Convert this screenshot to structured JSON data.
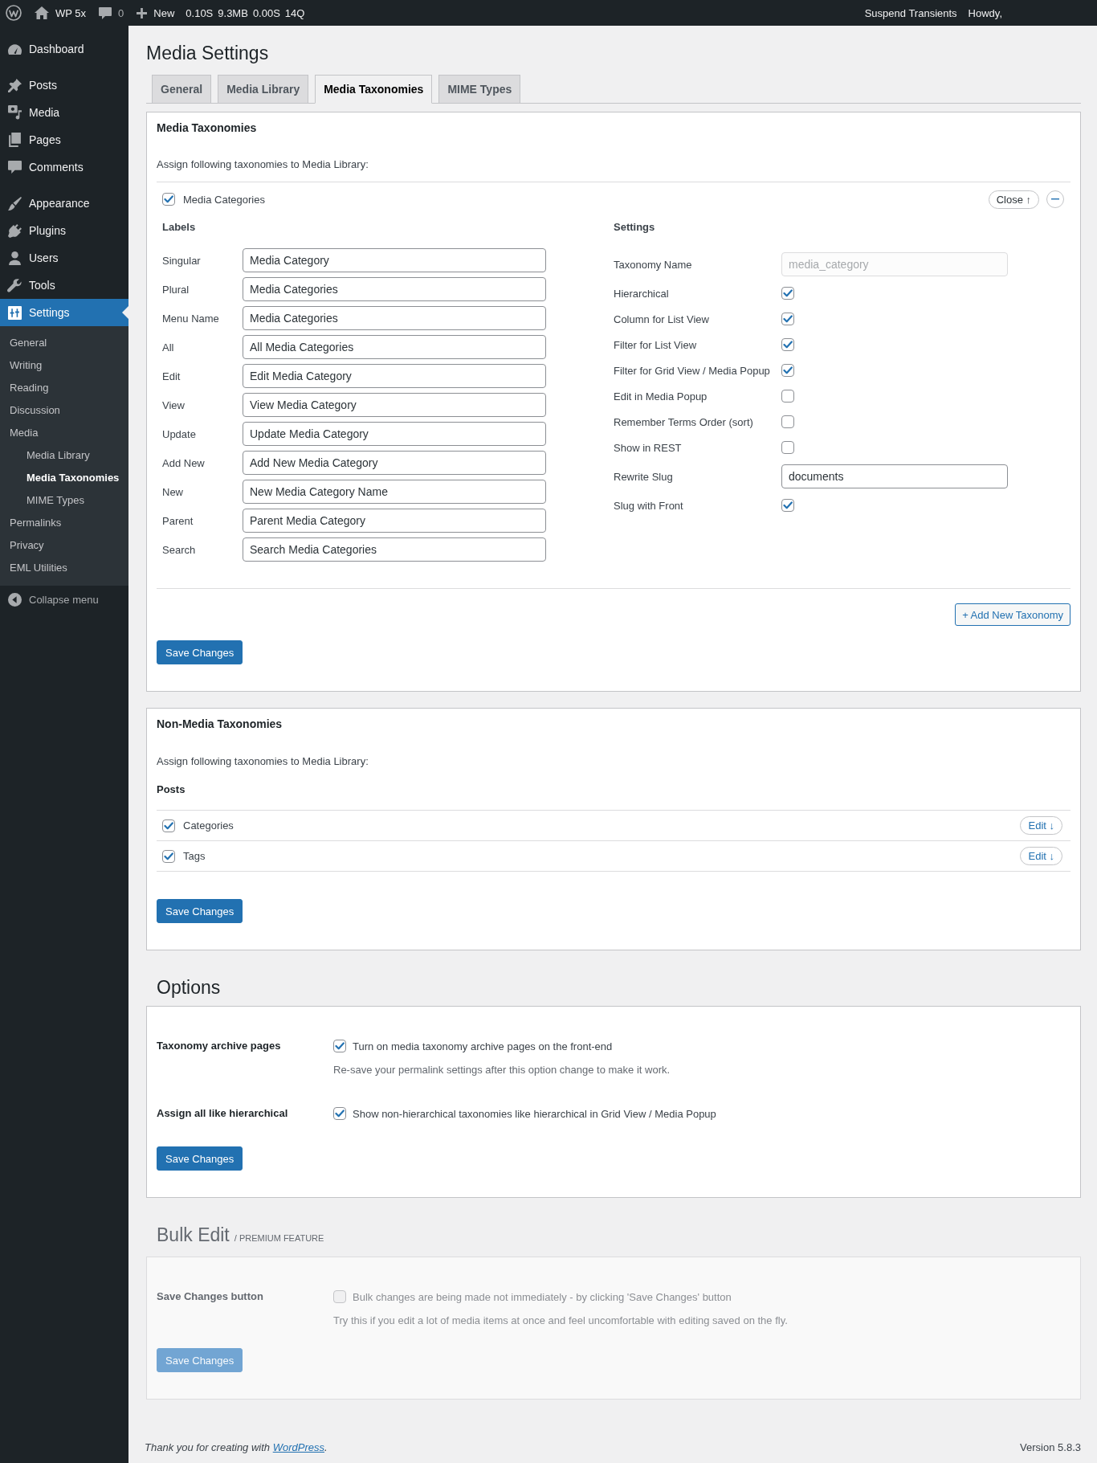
{
  "admin_bar": {
    "site_name": "WP 5x",
    "comments_count": "0",
    "new_label": "New",
    "stats": [
      "0.10S",
      "9.3MB",
      "0.00S",
      "14Q"
    ],
    "right_links": [
      "Suspend Transients",
      "Howdy,"
    ]
  },
  "sidebar": {
    "groups": [
      {
        "items": [
          {
            "label": "Dashboard",
            "selected": false
          }
        ]
      },
      {
        "items": [
          {
            "label": "Posts",
            "selected": false
          },
          {
            "label": "Media",
            "selected": false
          },
          {
            "label": "Pages",
            "selected": false
          },
          {
            "label": "Comments",
            "selected": false
          }
        ]
      },
      {
        "items": [
          {
            "label": "Appearance",
            "selected": false
          },
          {
            "label": "Plugins",
            "selected": false
          },
          {
            "label": "Users",
            "selected": false
          },
          {
            "label": "Tools",
            "selected": false
          },
          {
            "label": "Settings",
            "selected": true,
            "children": [
              {
                "label": "General",
                "selected": false
              },
              {
                "label": "Writing",
                "selected": false
              },
              {
                "label": "Reading",
                "selected": false
              },
              {
                "label": "Discussion",
                "selected": false
              },
              {
                "label": "Media",
                "selected": false,
                "children": [
                  {
                    "label": "Media Library",
                    "selected": false
                  },
                  {
                    "label": "Media Taxonomies",
                    "selected": true
                  },
                  {
                    "label": "MIME Types",
                    "selected": false
                  }
                ]
              },
              {
                "label": "Permalinks",
                "selected": false
              },
              {
                "label": "Privacy",
                "selected": false
              },
              {
                "label": "EML Utilities",
                "selected": false
              }
            ]
          }
        ]
      }
    ],
    "collapse_label": "Collapse menu"
  },
  "page_title": "Media Settings",
  "tabs": [
    {
      "label": "General",
      "selected": false
    },
    {
      "label": "Media Library",
      "selected": false
    },
    {
      "label": "Media Taxonomies",
      "selected": true
    },
    {
      "label": "MIME Types",
      "selected": false
    }
  ],
  "media_taxonomies": {
    "title": "Media Taxonomies",
    "intro": "Assign following taxonomies to Media Library:",
    "taxonomies": [
      {
        "label": "Media Categories",
        "checked": true,
        "expanded": true,
        "close_button": "Close ↑",
        "labels_heading": "Labels",
        "labels": [
          {
            "label": "Singular",
            "value": "Media Category"
          },
          {
            "label": "Plural",
            "value": "Media Categories"
          },
          {
            "label": "Menu Name",
            "value": "Media Categories"
          },
          {
            "label": "All",
            "value": "All Media Categories"
          },
          {
            "label": "Edit",
            "value": "Edit Media Category"
          },
          {
            "label": "View",
            "value": "View Media Category"
          },
          {
            "label": "Update",
            "value": "Update Media Category"
          },
          {
            "label": "Add New",
            "value": "Add New Media Category"
          },
          {
            "label": "New",
            "value": "New Media Category Name"
          },
          {
            "label": "Parent",
            "value": "Parent Media Category"
          },
          {
            "label": "Search",
            "value": "Search Media Categories"
          }
        ],
        "settings_heading": "Settings",
        "settings": [
          {
            "kind": "text",
            "label": "Taxonomy Name",
            "value": "media_category",
            "disabled": true
          },
          {
            "kind": "checkbox",
            "label": "Hierarchical",
            "checked": true
          },
          {
            "kind": "checkbox",
            "label": "Column for List View",
            "checked": true
          },
          {
            "kind": "checkbox",
            "label": "Filter for List View",
            "checked": true
          },
          {
            "kind": "checkbox",
            "label": "Filter for Grid View / Media Popup",
            "checked": true
          },
          {
            "kind": "checkbox",
            "label": "Edit in Media Popup",
            "checked": false
          },
          {
            "kind": "checkbox",
            "label": "Remember Terms Order (sort)",
            "checked": false
          },
          {
            "kind": "checkbox",
            "label": "Show in REST",
            "checked": false
          },
          {
            "kind": "text",
            "label": "Rewrite Slug",
            "value": "documents",
            "disabled": false
          },
          {
            "kind": "checkbox",
            "label": "Slug with Front",
            "checked": true
          }
        ]
      }
    ],
    "add_button": "+ Add New Taxonomy",
    "save_button": "Save Changes"
  },
  "non_media_taxonomies": {
    "title": "Non-Media Taxonomies",
    "intro": "Assign following taxonomies to Media Library:",
    "groups": [
      {
        "name": "Posts",
        "taxonomies": [
          {
            "label": "Categories",
            "checked": true,
            "edit_button": "Edit ↓"
          },
          {
            "label": "Tags",
            "checked": true,
            "edit_button": "Edit ↓"
          }
        ]
      }
    ],
    "save_button": "Save Changes"
  },
  "options": {
    "title": "Options",
    "rows": [
      {
        "label": "Taxonomy archive pages",
        "checked": true,
        "text": "Turn on media taxonomy archive pages on the front-end",
        "description": "Re-save your permalink settings after this option change to make it work."
      },
      {
        "label": "Assign all like hierarchical",
        "checked": true,
        "text": "Show non-hierarchical taxonomies like hierarchical in Grid View / Media Popup"
      }
    ],
    "save_button": "Save Changes"
  },
  "bulk_edit": {
    "title": "Bulk Edit",
    "note": "/ PREMIUM FEATURE",
    "disabled": true,
    "rows": [
      {
        "label": "Save Changes button",
        "checked": false,
        "text": "Bulk changes are being made not immediately - by clicking 'Save Changes' button",
        "description": "Try this if you edit a lot of media items at once and feel uncomfortable with editing saved on the fly."
      }
    ],
    "save_button": "Save Changes"
  },
  "footer": {
    "text": "Thank you for creating with",
    "link": "WordPress",
    "text_after": ".",
    "version": "Version 5.8.3"
  }
}
